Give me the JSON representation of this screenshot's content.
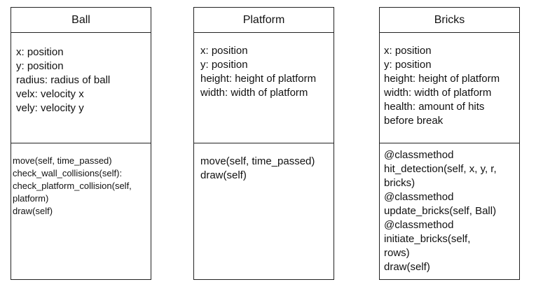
{
  "classes": {
    "ball": {
      "name": "Ball",
      "attributes": [
        "x: position",
        "y: position",
        "radius: radius of ball",
        "velx: velocity x",
        "vely: velocity y"
      ],
      "methods": [
        "move(self, time_passed)",
        "check_wall_collisions(self):",
        "check_platform_collision(self,",
        "platform)",
        "draw(self)"
      ]
    },
    "platform": {
      "name": "Platform",
      "attributes": [
        "x: position",
        "y: position",
        "height: height of platform",
        "width: width of platform"
      ],
      "methods": [
        "move(self, time_passed)",
        "draw(self)"
      ]
    },
    "bricks": {
      "name": "Bricks",
      "attributes": [
        "x: position",
        "y: position",
        "height: height of platform",
        "width: width of platform",
        "health: amount of hits",
        "before break"
      ],
      "methods": [
        "@classmethod",
        "hit_detection(self, x, y, r,",
        "bricks)",
        "@classmethod",
        "update_bricks(self, Ball)",
        "@classmethod",
        "initiate_bricks(self,",
        "rows)",
        "draw(self)"
      ]
    }
  }
}
